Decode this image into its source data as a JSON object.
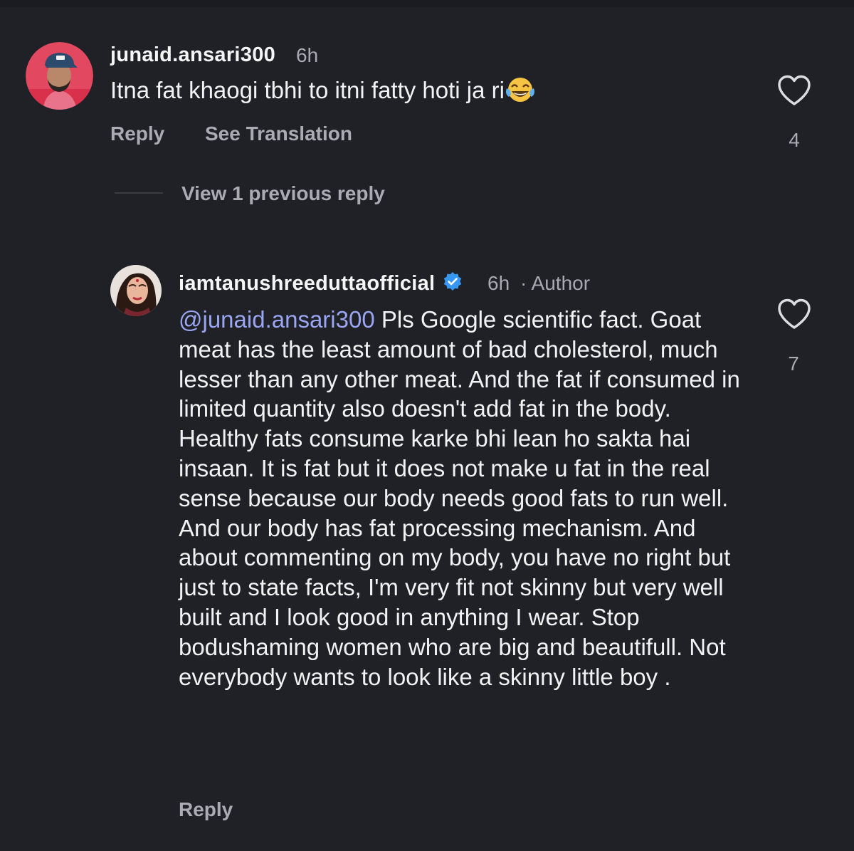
{
  "comments": [
    {
      "username": "junaid.ansari300",
      "time": "6h",
      "text": "Itna fat khaogi tbhi to itni fatty hoti ja ri",
      "emoji": "😂",
      "like_count": "4",
      "reply_label": "Reply",
      "translate_label": "See Translation"
    },
    {
      "username": "iamtanushreeduttaofficial",
      "time": "6h",
      "author_label": "· Author",
      "mention": "@junaid.ansari300",
      "text": " Pls Google scientific fact. Goat meat has the least amount of bad cholesterol, much lesser than any other meat. And the fat if consumed in limited quantity also doesn't add fat in the body. Healthy fats consume karke bhi lean ho sakta hai insaan. It is fat but it does not make u fat in the real sense because our body needs good fats to run well. And our body has fat processing mechanism. And about commenting on my body,  you have no right but just to state facts, I'm very fit not skinny but very well built and I look good in anything I wear. Stop bodushaming women who are big and beautifull. Not everybody wants to look like a skinny little boy .",
      "like_count": "7",
      "reply_label": "Reply"
    }
  ],
  "view_replies_label": "View 1 previous reply",
  "icons": {
    "heart": "heart-outline-icon",
    "verified": "verified-badge-icon"
  },
  "colors": {
    "background": "#1f2127",
    "mention": "#9aa6f2",
    "verified": "#3897f0"
  }
}
